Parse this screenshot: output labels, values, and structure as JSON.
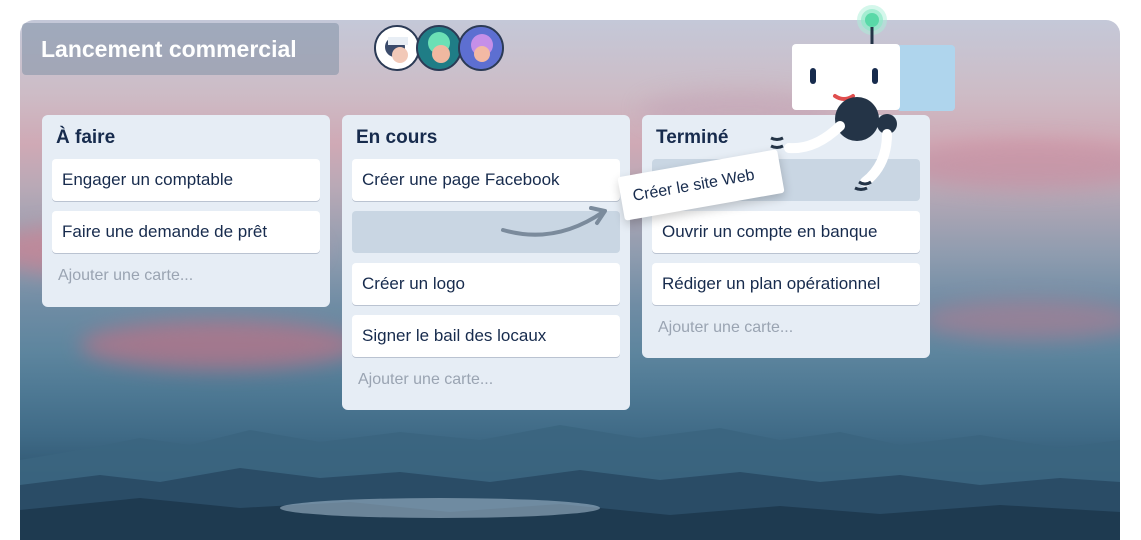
{
  "board": {
    "title": "Lancement commercial",
    "avatars": [
      "avatar-1",
      "avatar-2",
      "avatar-3"
    ]
  },
  "lists": [
    {
      "title": "À faire",
      "cards": [
        "Engager un comptable",
        "Faire une demande de prêt"
      ],
      "add_card": "Ajouter une carte..."
    },
    {
      "title": "En cours",
      "cards": [
        "Créer une page Facebook",
        "Créer un logo",
        "Signer le bail des locaux"
      ],
      "add_card": "Ajouter une carte..."
    },
    {
      "title": "Terminé",
      "cards": [
        "Ouvrir un compte en banque",
        "Rédiger un plan opérationnel"
      ],
      "add_card": "Ajouter une carte..."
    }
  ],
  "dragged_card": "Créer le site Web",
  "icons": [
    "arrow-icon",
    "robot-mascot-icon",
    "antenna-signal-icon"
  ],
  "colors": {
    "list_bg": "#e6edf5",
    "text": "#172b4d",
    "placeholder": "#c9d6e3",
    "add_card_text": "#9aa4b2"
  }
}
